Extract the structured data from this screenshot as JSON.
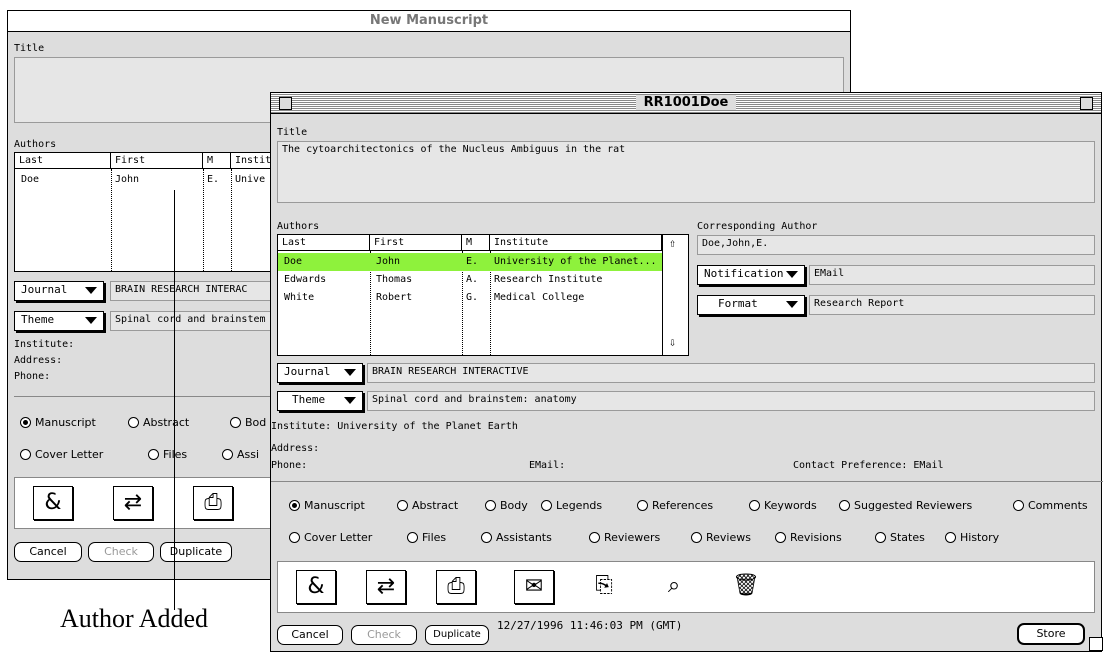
{
  "back_window": {
    "title": "New Manuscript",
    "title_label": "Title",
    "authors_label": "Authors",
    "columns": [
      "Last",
      "First",
      "M",
      "Instit"
    ],
    "rows": [
      {
        "last": "Doe",
        "first": "John",
        "m": "E.",
        "inst": "Unive"
      }
    ],
    "journal_btn": "Journal",
    "journal_value": "BRAIN RESEARCH INTERAC",
    "theme_btn": "Theme",
    "theme_value": "Spinal cord and brainstem",
    "institute": "Institute:",
    "address": "Address:",
    "phone": "Phone:",
    "radios": [
      {
        "label": "Manuscript",
        "checked": true
      },
      {
        "label": "Abstract",
        "checked": false
      },
      {
        "label": "Bod",
        "checked": false
      },
      {
        "label": "Cover Letter",
        "checked": false
      },
      {
        "label": "Files",
        "checked": false
      },
      {
        "label": "Assi",
        "checked": false
      }
    ],
    "buttons": {
      "cancel": "Cancel",
      "check": "Check",
      "duplicate": "Duplicate"
    }
  },
  "front_window": {
    "title": "RR1001Doe",
    "title_label": "Title",
    "title_value": "The cytoarchitectonics of the Nucleus Ambiguus in the rat",
    "authors_label": "Authors",
    "columns": [
      "Last",
      "First",
      "M",
      "Institute"
    ],
    "rows": [
      {
        "last": "Doe",
        "first": "John",
        "m": "E.",
        "inst": "University of the Planet...",
        "selected": true
      },
      {
        "last": "Edwards",
        "first": "Thomas",
        "m": "A.",
        "inst": "Research Institute",
        "selected": false
      },
      {
        "last": "White",
        "first": "Robert",
        "m": "G.",
        "inst": "Medical College",
        "selected": false
      }
    ],
    "corresponding_label": "Corresponding Author",
    "corresponding_value": "Doe,John,E.",
    "notification_btn": "Notification",
    "notification_value": "EMail",
    "format_btn": "Format",
    "format_value": "Research Report",
    "journal_btn": "Journal",
    "journal_value": "BRAIN RESEARCH INTERACTIVE",
    "theme_btn": "Theme",
    "theme_value": "Spinal cord and brainstem: anatomy",
    "institute": "Institute: University of the Planet Earth",
    "address": "Address:",
    "phone": "Phone:",
    "email": "EMail:",
    "contact": "Contact Preference: EMail",
    "radios_row1": [
      {
        "label": "Manuscript",
        "checked": true
      },
      {
        "label": "Abstract",
        "checked": false
      },
      {
        "label": "Body",
        "checked": false
      },
      {
        "label": "Legends",
        "checked": false
      },
      {
        "label": "References",
        "checked": false
      },
      {
        "label": "Keywords",
        "checked": false
      },
      {
        "label": "Suggested Reviewers",
        "checked": false
      },
      {
        "label": "Comments",
        "checked": false
      }
    ],
    "radios_row2": [
      {
        "label": "Cover Letter",
        "checked": false
      },
      {
        "label": "Files",
        "checked": false
      },
      {
        "label": "Assistants",
        "checked": false
      },
      {
        "label": "Reviewers",
        "checked": false
      },
      {
        "label": "Reviews",
        "checked": false
      },
      {
        "label": "Revisions",
        "checked": false
      },
      {
        "label": "States",
        "checked": false
      },
      {
        "label": "History",
        "checked": false
      }
    ],
    "icons": [
      "ampersand-doc-icon",
      "transfer-icon",
      "print-icon",
      "mail-icon",
      "export-icon",
      "search-icon",
      "trash-icon"
    ],
    "buttons": {
      "cancel": "Cancel",
      "check": "Check",
      "duplicate": "Duplicate",
      "store": "Store"
    },
    "timestamp": "12/27/1996 11:46:03 PM (GMT)"
  },
  "annotation": "Author Added"
}
